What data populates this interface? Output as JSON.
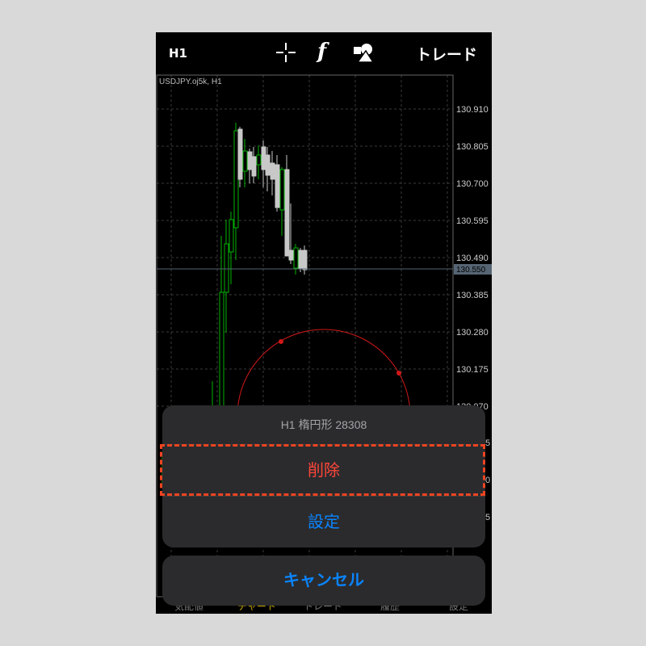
{
  "toolbar": {
    "timeframe": "H1",
    "crosshair_icon": "crosshair-icon",
    "function_glyph": "f",
    "objects_icon": "shapes-icon",
    "trade_label": "トレード"
  },
  "chart": {
    "symbol_label": "USDJPY.oj5k, H1",
    "price_ticks": [
      "130.910",
      "130.805",
      "130.700",
      "130.595",
      "130.490",
      "130.385",
      "130.280",
      "130.175",
      "130.070"
    ],
    "current_price": "130.550",
    "partial_tick_labels": [
      "5",
      "0",
      "5"
    ],
    "colors": {
      "background": "#000000",
      "grid": "#3a3a3a",
      "bull_candle": "#00b400",
      "bear_candle": "#c8c8c8",
      "ellipse": "#d01818",
      "price_line": "#566573"
    }
  },
  "bottom_tabs": [
    "気配値",
    "チャート",
    "トレード",
    "履歴",
    "設定"
  ],
  "action_sheet": {
    "title": "H1 楕円形 28308",
    "delete_label": "削除",
    "settings_label": "設定",
    "cancel_label": "キャンセル"
  }
}
